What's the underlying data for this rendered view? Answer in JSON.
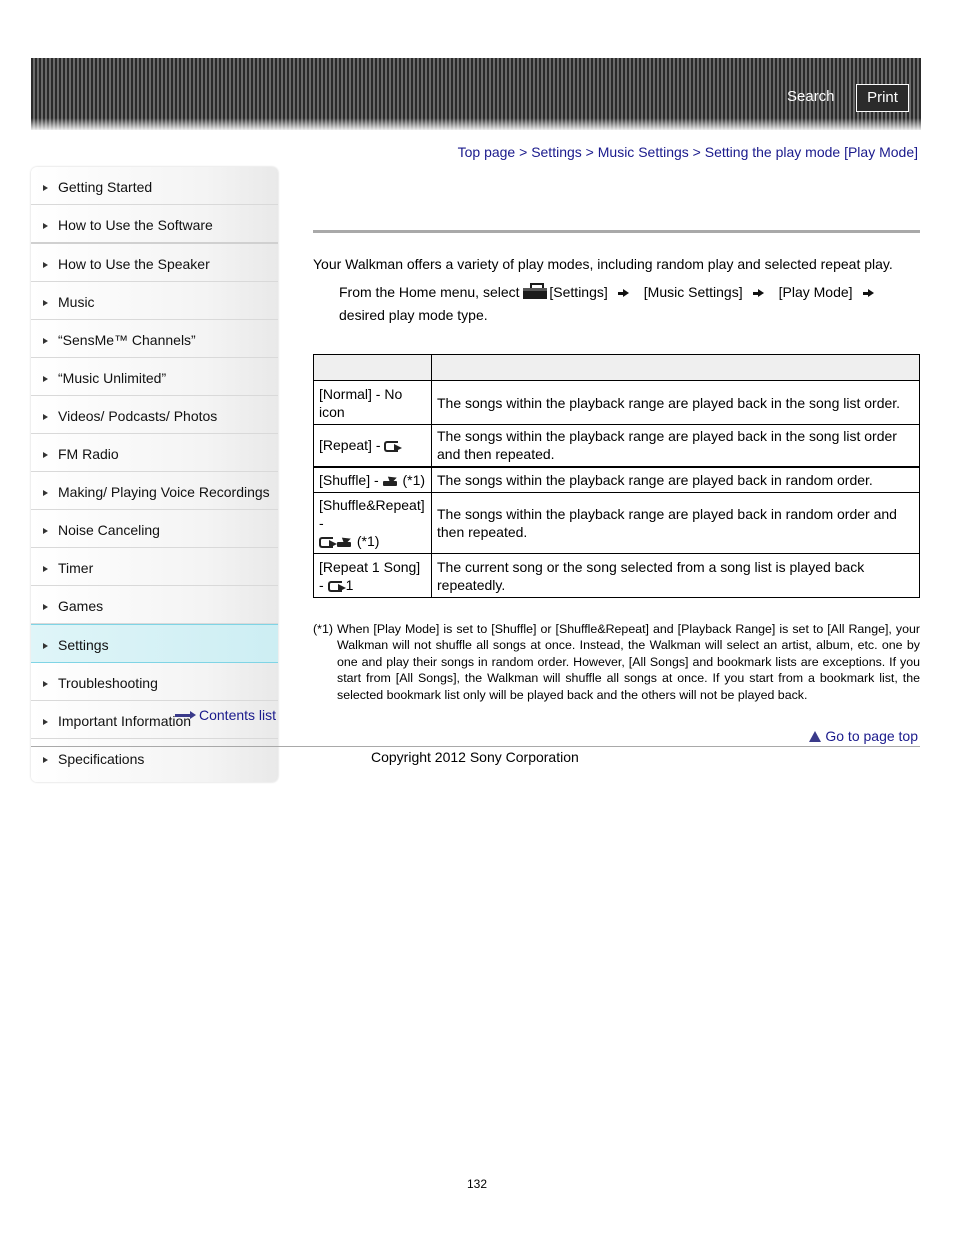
{
  "header": {
    "search_label": "Search",
    "print_label": "Print"
  },
  "sidebar": {
    "items": [
      {
        "label": "Getting Started"
      },
      {
        "label": "How to Use the Software"
      },
      {
        "label": "How to Use the Speaker"
      },
      {
        "label": "Music"
      },
      {
        "label": "“SensMe™ Channels”"
      },
      {
        "label": "“Music Unlimited”"
      },
      {
        "label": "Videos/ Podcasts/ Photos"
      },
      {
        "label": "FM Radio"
      },
      {
        "label": "Making/ Playing Voice Recordings"
      },
      {
        "label": "Noise Canceling"
      },
      {
        "label": "Timer"
      },
      {
        "label": "Games"
      },
      {
        "label": "Settings",
        "active": true
      },
      {
        "label": "Troubleshooting"
      },
      {
        "label": "Important Information"
      },
      {
        "label": "Specifications"
      }
    ],
    "contents_list_label": "Contents list"
  },
  "breadcrumb": {
    "items": [
      "Top page",
      "Settings",
      "Music Settings",
      "Setting the play mode [Play Mode]"
    ],
    "separator": " > "
  },
  "main": {
    "intro": "Your Walkman offers a variety of play modes, including random play and selected repeat play.",
    "step": {
      "prefix": "From the Home menu, select",
      "icon": "toolbox-icon",
      "path": [
        "[Settings]",
        "[Music Settings]",
        "[Play Mode]"
      ],
      "suffix": "desired play mode type."
    },
    "table": {
      "headers": [
        "",
        ""
      ],
      "rows": [
        {
          "mode": "[Normal] - No icon",
          "icon": "",
          "note": "",
          "description": "The songs within the playback range are played back in the song list order."
        },
        {
          "mode": "[Repeat] -",
          "icon": "repeat-icon",
          "note": "",
          "description": "The songs within the playback range are played back in the song list order and then repeated."
        },
        {
          "mode": "[Shuffle] -",
          "icon": "shuffle-icon",
          "note": "(*1)",
          "description": "The songs within the playback range are played back in random order."
        },
        {
          "mode": "[Shuffle&Repeat] -",
          "icon": "shuffle-repeat-icon",
          "note": "(*1)",
          "description": "The songs within the playback range are played back in random order and then repeated."
        },
        {
          "mode": "[Repeat 1 Song] -",
          "icon": "repeat-one-icon",
          "note": "",
          "description": "The current song or the song selected from a song list is played back repeatedly."
        }
      ]
    },
    "footnote": {
      "mark": "(*1)",
      "text": "When [Play Mode] is set to [Shuffle] or [Shuffle&Repeat] and [Playback Range] is set to [All Range], your Walkman will not shuffle all songs at once. Instead, the Walkman will select an artist, album, etc. one by one and play their songs in random order. However, [All Songs] and bookmark lists are exceptions. If you start from [All Songs], the Walkman will shuffle all songs at once. If you start from a bookmark list, the selected bookmark list only will be played back and the others will not be played back."
    },
    "go_to_top_label": "Go to page top"
  },
  "footer": {
    "copyright": "Copyright 2012 Sony Corporation",
    "page_number": "132"
  }
}
